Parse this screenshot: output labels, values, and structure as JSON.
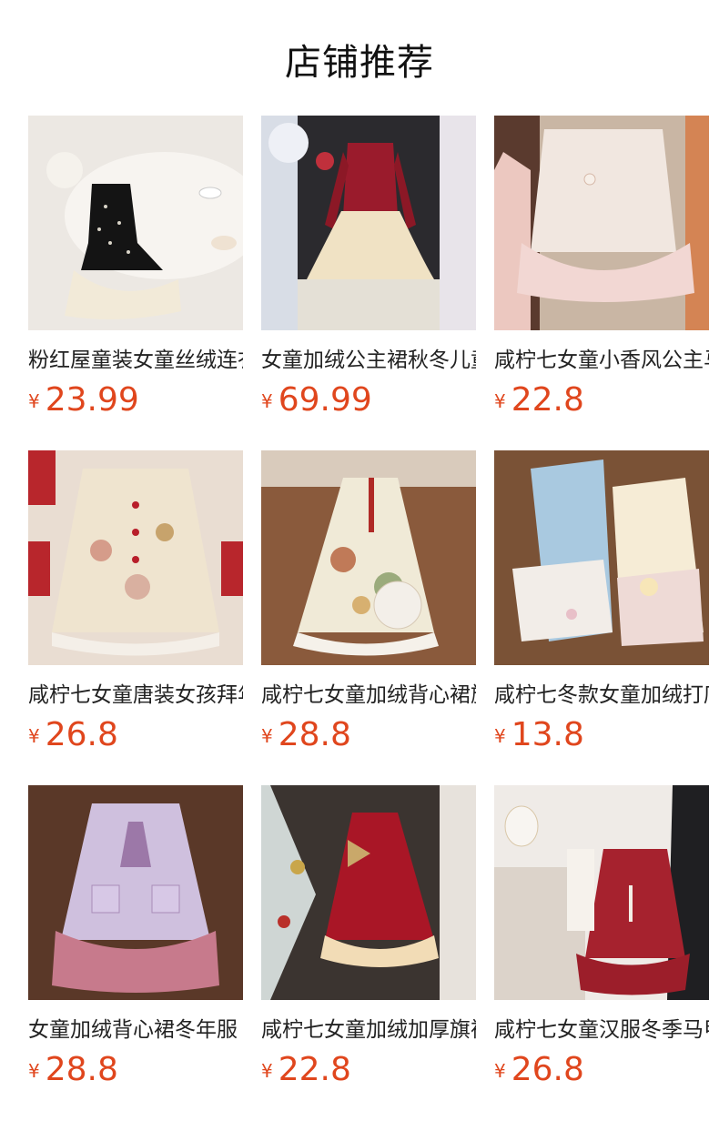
{
  "header": {
    "title": "店铺推荐"
  },
  "currency": "¥",
  "products": [
    {
      "name": "粉红屋童装女童丝绒连衣裙秋冬",
      "price": "23.99",
      "image": "black-velvet-dress-photo"
    },
    {
      "name": "女童加绒公主裙秋冬儿童纱裙",
      "price": "69.99",
      "image": "red-sequin-tulle-dress-photo"
    },
    {
      "name": "咸柠七女童小香风公主马甲裙",
      "price": "22.8",
      "image": "pink-tweed-vest-dress-photo"
    },
    {
      "name": "咸柠七女童唐装女孩拜年服",
      "price": "26.8",
      "image": "tang-style-fur-jacket-photo"
    },
    {
      "name": "咸柠七女童加绒背心裙旗袍",
      "price": "28.8",
      "image": "qipao-fur-trim-dress-photo"
    },
    {
      "name": "咸柠七冬款女童加绒打底裤",
      "price": "13.8",
      "image": "fleece-leggings-photo"
    },
    {
      "name": "女童加绒背心裙冬年服",
      "price": "28.8",
      "image": "purple-tweed-tutu-vest-photo"
    },
    {
      "name": "咸柠七女童加绒加厚旗袍裙",
      "price": "22.8",
      "image": "red-sequin-bow-dress-photo"
    },
    {
      "name": "咸柠七女童汉服冬季马甲裙",
      "price": "26.8",
      "image": "red-hanfu-vest-dress-photo"
    }
  ]
}
